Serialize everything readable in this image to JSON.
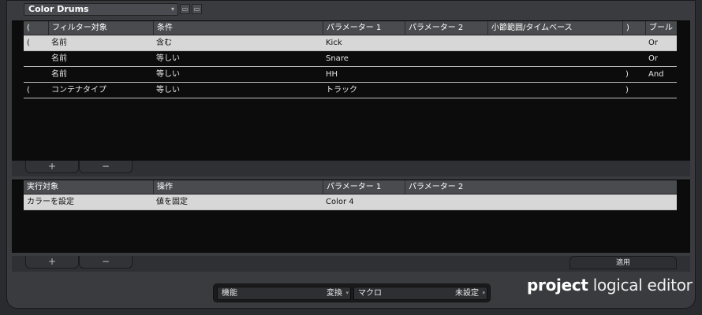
{
  "preset": {
    "name": "Color Drums",
    "icons": [
      "add-preset-icon",
      "remove-preset-icon"
    ]
  },
  "filter": {
    "columns": [
      "(",
      "フィルター対象",
      "条件",
      "パラメーター 1",
      "パラメーター 2",
      "小節範囲/タイムベース",
      ")",
      "ブール"
    ],
    "rows": [
      {
        "open": "(",
        "target": "名前",
        "condition": "含む",
        "param1": "Kick",
        "param2": "",
        "range": "",
        "close": "",
        "bool": "Or",
        "selected": true
      },
      {
        "open": "",
        "target": "名前",
        "condition": "等しい",
        "param1": "Snare",
        "param2": "",
        "range": "",
        "close": "",
        "bool": "Or",
        "selected": false
      },
      {
        "open": "",
        "target": "名前",
        "condition": "等しい",
        "param1": "HH",
        "param2": "",
        "range": "",
        "close": ")",
        "bool": "And",
        "selected": false
      },
      {
        "open": "(",
        "target": "コンテナタイプ",
        "condition": "等しい",
        "param1": "トラック",
        "param2": "",
        "range": "",
        "close": ")",
        "bool": "",
        "selected": false
      }
    ],
    "add_label": "+",
    "remove_label": "−"
  },
  "action": {
    "columns": [
      "実行対象",
      "操作",
      "パラメーター 1",
      "パラメーター 2"
    ],
    "rows": [
      {
        "target": "カラーを設定",
        "operation": "値を固定",
        "param1": "Color 4",
        "param2": "",
        "selected": true
      }
    ],
    "add_label": "+",
    "remove_label": "−",
    "apply_label": "適用"
  },
  "footer": {
    "function_label": "機能",
    "function_value": "変換",
    "macro_label": "マクロ",
    "macro_value": "未設定"
  },
  "brand": {
    "bold": "project",
    "rest": "logical editor"
  }
}
